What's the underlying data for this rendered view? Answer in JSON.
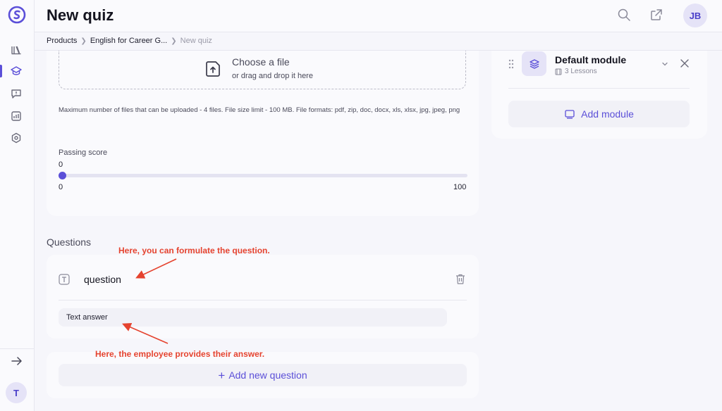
{
  "header": {
    "title": "New quiz",
    "avatar_initials": "JB"
  },
  "breadcrumb": {
    "items": [
      "Products",
      "English for Career G..."
    ],
    "current": "New quiz"
  },
  "sidebar": {
    "user_initial": "T"
  },
  "upload": {
    "title": "Choose a file",
    "subtitle": "or drag and drop it here",
    "note": "Maximum number of files that can be uploaded - 4 files. File size limit - 100 MB. File formats: pdf, zip, doc, docx, xls, xlsx, jpg, jpeg, png"
  },
  "passing_score": {
    "label": "Passing score",
    "value": "0",
    "min": "0",
    "max": "100",
    "fraction": 0
  },
  "questions": {
    "heading": "Questions",
    "items": [
      {
        "text": "question",
        "answer_type": "Text answer"
      }
    ],
    "add_label": "Add new question"
  },
  "module": {
    "title": "Default module",
    "lessons": "3 Lessons",
    "add_label": "Add module"
  },
  "annotations": {
    "question_hint": "Here, you can formulate the question.",
    "answer_hint": "Here, the employee provides their answer."
  },
  "colors": {
    "accent": "#5b4fd8",
    "annotation": "#e5432f"
  }
}
